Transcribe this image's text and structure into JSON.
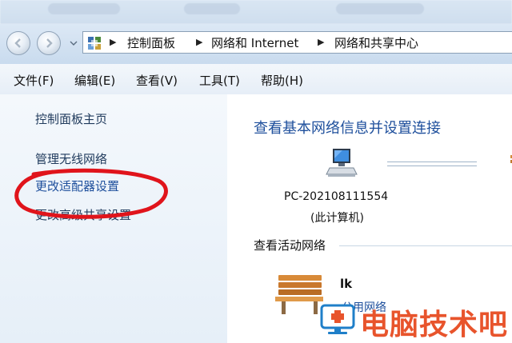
{
  "address_bar": {
    "breadcrumbs": [
      "控制面板",
      "网络和 Internet",
      "网络和共享中心"
    ]
  },
  "menu": {
    "items": [
      "文件(F)",
      "编辑(E)",
      "查看(V)",
      "工具(T)",
      "帮助(H)"
    ]
  },
  "sidebar": {
    "links": [
      "控制面板主页",
      "管理无线网络",
      "更改适配器设置",
      "更改高级共享设置"
    ]
  },
  "main": {
    "title": "查看基本网络信息并设置连接",
    "computer_name": "PC-202108111554",
    "computer_sub": "(此计算机)",
    "active_networks_label": "查看活动网络",
    "network_name": "lk",
    "network_type": "公用网络"
  },
  "watermark": {
    "text": "电脑技术吧"
  },
  "colors": {
    "link": "#1f3a5c",
    "title": "#1e4f9c",
    "annotation": "#e0141b",
    "watermark": "#e8542c"
  }
}
